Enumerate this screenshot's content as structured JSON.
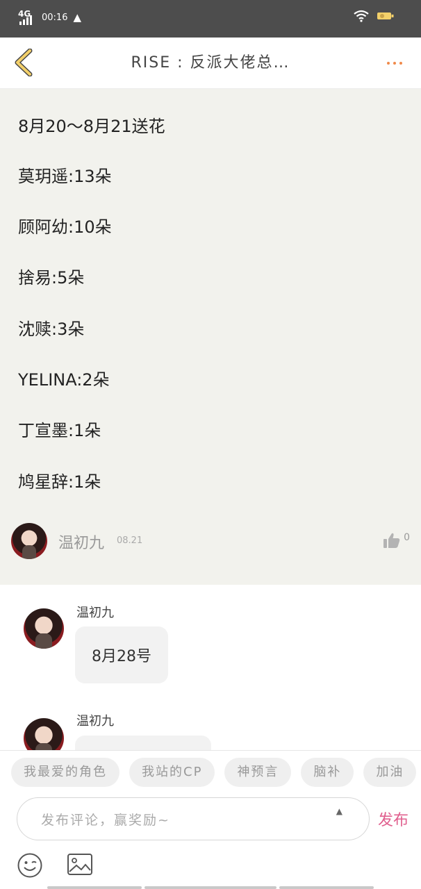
{
  "status_bar": {
    "network": "4G",
    "time": "00:16",
    "battery_icon": "battery-icon"
  },
  "header": {
    "title": "RISE : 反派大佬总…"
  },
  "post": {
    "lines": [
      "8月20～8月21送花",
      "莫玥遥:13朵",
      "顾阿幼:10朵",
      "捨易:5朵",
      "沈赎:3朵",
      "YELINA:2朵",
      "丁宣墨:1朵",
      "鸠星辞:1朵"
    ],
    "author": {
      "name": "温初九",
      "time": "08.21",
      "likes": "0"
    }
  },
  "comments": [
    {
      "name": "温初九",
      "text": "8月28号"
    },
    {
      "name": "温初九",
      "text": ""
    }
  ],
  "composer": {
    "tags": [
      "我最爱的角色",
      "我站的CP",
      "神预言",
      "脑补",
      "加油"
    ],
    "placeholder": "发布评论，赢奖励~",
    "publish_label": "发布"
  },
  "colors": {
    "accent_publish": "#e05f8e",
    "more_dots": "#f08a4b",
    "back_arrow": "#f3d06a",
    "post_background": "#f2f2ed"
  }
}
